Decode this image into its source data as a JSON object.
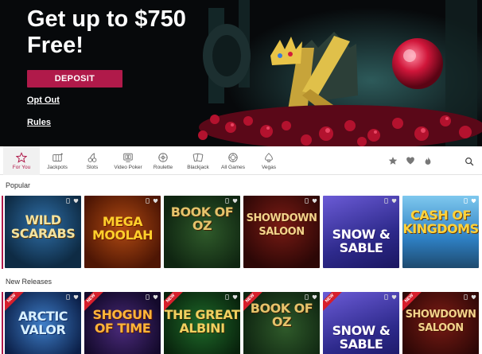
{
  "hero": {
    "headline": "Get up to $750 Free!",
    "deposit_label": "DEPOSIT",
    "opt_out_label": "Opt Out",
    "rules_label": "Rules"
  },
  "nav": {
    "items": [
      {
        "label": "For You",
        "icon": "star-icon",
        "active": true
      },
      {
        "label": "Jackpots",
        "icon": "jackpot-icon"
      },
      {
        "label": "Slots",
        "icon": "cherries-icon"
      },
      {
        "label": "Video Poker",
        "icon": "video-poker-icon"
      },
      {
        "label": "Roulette",
        "icon": "roulette-icon"
      },
      {
        "label": "Blackjack",
        "icon": "cards-icon"
      },
      {
        "label": "All Games",
        "icon": "chip-icon"
      },
      {
        "label": "Vegas",
        "icon": "spade-icon"
      }
    ],
    "right_icons": [
      "star-filled-icon",
      "heart-icon",
      "flame-icon",
      "search-icon"
    ]
  },
  "sections": {
    "popular": {
      "title": "Popular",
      "games": [
        "Wild Scarabs",
        "Mega Moolah",
        "Book of Oz",
        "Showdown Saloon",
        "Snow & Sable",
        "Cash of Kingdoms"
      ]
    },
    "new_releases": {
      "title": "New Releases",
      "new_badge": "NEW",
      "games": [
        "Arctic Valor",
        "Shogun of Time",
        "The Great Albini",
        "Book of Oz",
        "Snow & Sable",
        "Showdown Saloon"
      ]
    }
  },
  "colors": {
    "accent": "#b01a4a",
    "hero_bg": "#07090b",
    "new_ribbon": "#d61f2c"
  }
}
